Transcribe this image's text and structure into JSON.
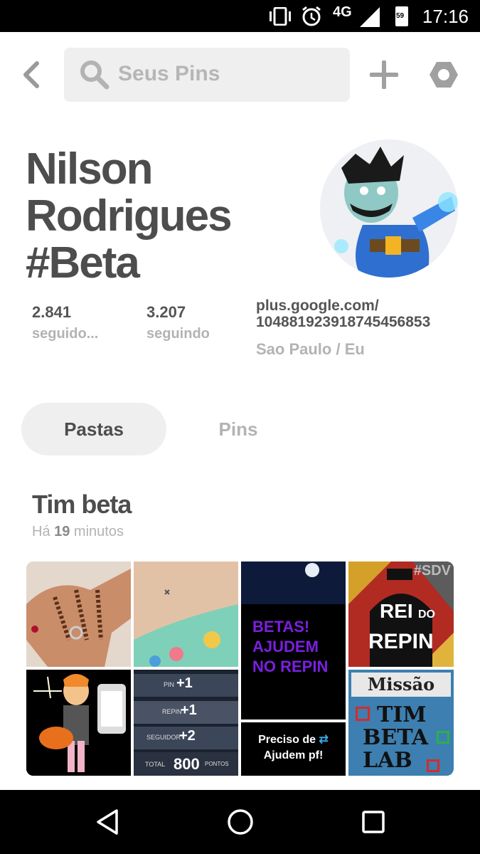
{
  "status_bar": {
    "time": "17:16",
    "network": "4G",
    "battery": "59"
  },
  "header": {
    "search_placeholder": "Seus Pins"
  },
  "profile": {
    "name_line1": "Nilson",
    "name_line2": "Rodrigues",
    "name_line3": "#Beta",
    "followers_count": "2.841",
    "followers_label": "seguido...",
    "following_count": "3.207",
    "following_label": "seguindo",
    "link_line1": "plus.google.com/",
    "link_line2": "104881923918745456853",
    "location": "Sao Paulo / Eu"
  },
  "tabs": {
    "boards": "Pastas",
    "pins": "Pins"
  },
  "board": {
    "title": "Tim beta",
    "time_prefix": "Há ",
    "time_value": "19",
    "time_suffix": " minutos",
    "tiles": {
      "betas_text_l1": "BETAS!",
      "betas_text_l2": "AJUDEM",
      "betas_text_l3": "NO REPIN",
      "rei_l1": "REI",
      "rei_do": "DO",
      "rei_l2": "REPIN",
      "rei_tag": "#SDV",
      "preciso_l1": "Preciso de",
      "preciso_l2": "Ajudem pf!",
      "missao": "Missão",
      "tim": "TIM",
      "beta": "BETA",
      "lab": "LAB",
      "pin_label": "PIN",
      "repin_label": "REPIN",
      "seguidor_label": "SEGUIDOR",
      "total_label": "TOTAL",
      "plus1a": "+1",
      "plus1b": "+1",
      "plus2": "+2",
      "total_value": "800",
      "pontos": "PONTOS"
    }
  },
  "colors": {
    "accent_purple": "#7b1fe0",
    "text_dark": "#4d4d4d",
    "text_muted": "#b3b3b3"
  }
}
